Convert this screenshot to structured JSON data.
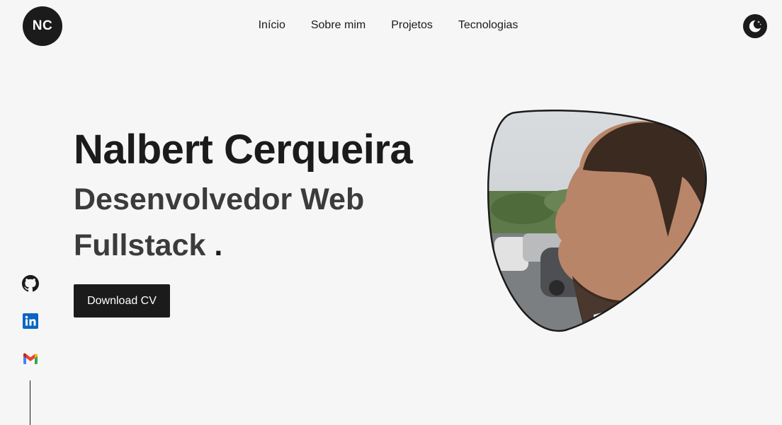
{
  "header": {
    "logo_text": "NC",
    "nav": [
      "Início",
      "Sobre mim",
      "Projetos",
      "Tecnologias"
    ],
    "theme_toggle_icon": "moon-stars-icon"
  },
  "hero": {
    "name": "Nalbert Cerqueira",
    "role_line1": "Desenvolvedor Web",
    "role_line2": "Fullstack",
    "role_suffix": ".",
    "cv_button": "Download CV",
    "photo_icon": "profile-photo"
  },
  "social": {
    "icons": [
      "github-icon",
      "linkedin-icon",
      "gmail-icon"
    ]
  },
  "colors": {
    "background": "#f6f6f6",
    "primary": "#1b1b1b",
    "role_text": "#3b3b3b",
    "linkedin": "#0a66c2"
  }
}
